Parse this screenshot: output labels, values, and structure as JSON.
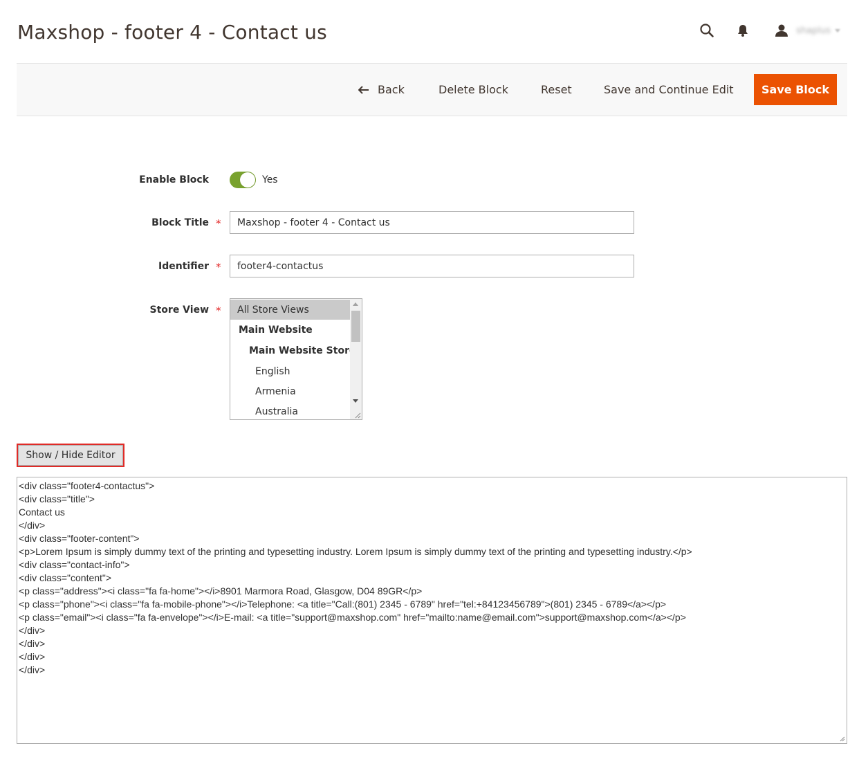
{
  "header": {
    "title": "Maxshop - footer 4 - Contact us",
    "icons": [
      "search-icon",
      "bell-icon",
      "user-icon"
    ],
    "user_name": "shaplus"
  },
  "actions": {
    "back": "Back",
    "delete": "Delete Block",
    "reset": "Reset",
    "save_continue": "Save and Continue Edit",
    "save": "Save Block"
  },
  "form": {
    "enable_block": {
      "label": "Enable Block",
      "value": "Yes",
      "enabled": true
    },
    "block_title": {
      "label": "Block Title",
      "value": "Maxshop - footer 4 - Contact us"
    },
    "identifier": {
      "label": "Identifier",
      "value": "footer4-contactus"
    },
    "store_view": {
      "label": "Store View",
      "options": [
        "All Store Views",
        "Main Website",
        "Main Website Store",
        "English",
        "Armenia",
        "Australia"
      ],
      "selected": "All Store Views"
    },
    "required_mark": "*"
  },
  "editor": {
    "toggle_label": "Show / Hide Editor",
    "lines": [
      "<div class=\"footer4-contactus\">",
      "<div class=\"title\">",
      "Contact us",
      "</div>",
      "<div class=\"footer-content\">",
      "<p>Lorem Ipsum is simply dummy text of the printing and typesetting industry. Lorem Ipsum is simply dummy text of the printing and typesetting industry.</p>",
      "<div class=\"contact-info\">",
      "<div class=\"content\">",
      "<p class=\"address\"><i class=\"fa fa-home\"></i>8901 Marmora Road, Glasgow, D04 89GR</p>",
      "<p class=\"phone\"><i class=\"fa fa-mobile-phone\"></i>Telephone: <a title=\"Call:(801) 2345 - 6789\" href=\"tel:+84123456789\">(801) 2345 - 6789</a></p>",
      "<p class=\"email\"><i class=\"fa fa-envelope\"></i>E-mail: <a title=\"support@maxshop.com\" href=\"mailto:name@email.com\">support@maxshop.com</a></p>",
      "</div>",
      "</div>",
      "</div>",
      "</div>"
    ]
  },
  "colors": {
    "primary_button": "#eb5202",
    "toggle_on": "#79a22e",
    "required": "#e22626",
    "highlight_border": "#e02b27"
  }
}
